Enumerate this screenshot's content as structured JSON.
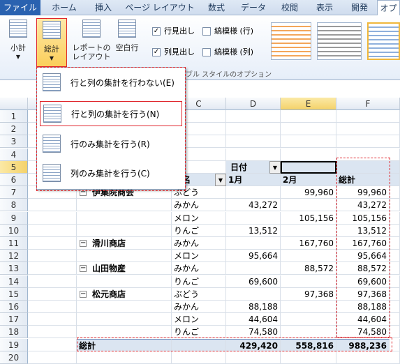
{
  "ribbon": {
    "tabs": [
      "ファイル",
      "ホーム",
      "挿入",
      "ページ レイアウト",
      "数式",
      "データ",
      "校閲",
      "表示",
      "開発",
      "オプ"
    ],
    "buttons": {
      "subtotal": "小計",
      "grand_total": "総計",
      "report_layout_1": "レポートの",
      "report_layout_2": "レイアウト",
      "blank_rows_1": "空白行"
    },
    "options": {
      "row_headers": "行見出し",
      "col_headers": "列見出し",
      "banded_rows": "縞模様 (行)",
      "banded_cols": "縞模様 (列)",
      "group_label": "ブル スタイルのオプション"
    }
  },
  "menu": {
    "items": [
      "行と列の集計を行わない(E)",
      "行と列の集計を行う(N)",
      "行のみ集計を行う(R)",
      "列のみ集計を行う(C)"
    ]
  },
  "sheet": {
    "columns": [
      "C",
      "D",
      "E",
      "F"
    ],
    "rows": [
      "1",
      "2",
      "3",
      "4",
      "5",
      "6",
      "7",
      "8",
      "9",
      "10",
      "11",
      "12",
      "13",
      "14",
      "15",
      "16",
      "17",
      "18",
      "19",
      "20"
    ],
    "header": {
      "date_label": "日付",
      "product_label": "品名",
      "jan": "1月",
      "feb": "2月",
      "total": "総計"
    },
    "data": [
      {
        "store": "伊集院商会",
        "product": "ぶどう",
        "jan": "",
        "feb": "99,960",
        "total": "99,960"
      },
      {
        "store": "",
        "product": "みかん",
        "jan": "43,272",
        "feb": "",
        "total": "43,272"
      },
      {
        "store": "",
        "product": "メロン",
        "jan": "",
        "feb": "105,156",
        "total": "105,156"
      },
      {
        "store": "",
        "product": "りんご",
        "jan": "13,512",
        "feb": "",
        "total": "13,512"
      },
      {
        "store": "滑川商店",
        "product": "みかん",
        "jan": "",
        "feb": "167,760",
        "total": "167,760"
      },
      {
        "store": "",
        "product": "メロン",
        "jan": "95,664",
        "feb": "",
        "total": "95,664"
      },
      {
        "store": "山田物産",
        "product": "みかん",
        "jan": "",
        "feb": "88,572",
        "total": "88,572"
      },
      {
        "store": "",
        "product": "りんご",
        "jan": "69,600",
        "feb": "",
        "total": "69,600"
      },
      {
        "store": "松元商店",
        "product": "ぶどう",
        "jan": "",
        "feb": "97,368",
        "total": "97,368"
      },
      {
        "store": "",
        "product": "みかん",
        "jan": "88,188",
        "feb": "",
        "total": "88,188"
      },
      {
        "store": "",
        "product": "メロン",
        "jan": "44,604",
        "feb": "",
        "total": "44,604"
      },
      {
        "store": "",
        "product": "りんご",
        "jan": "74,580",
        "feb": "",
        "total": "74,580"
      }
    ],
    "grand_total": {
      "label": "総計",
      "jan": "429,420",
      "feb": "558,816",
      "total": "988,236"
    }
  },
  "colors": {
    "accent_red": "#e0262c",
    "selected_header": "#f4d26a"
  }
}
